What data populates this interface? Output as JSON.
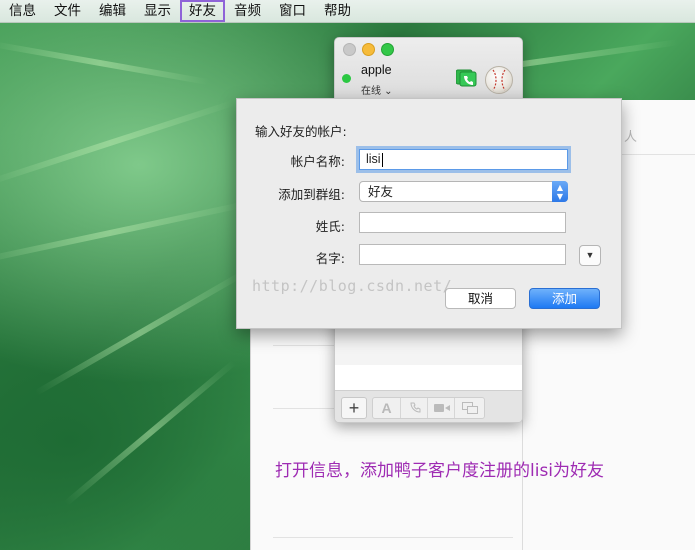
{
  "menubar": {
    "items": [
      "信息",
      "文件",
      "编辑",
      "显示",
      "好友",
      "音频",
      "窗口",
      "帮助"
    ],
    "active_index": 4
  },
  "messages_window": {
    "account_name": "apple",
    "account_status": "在线 ⌄",
    "status_color": "#2bc842"
  },
  "dialog": {
    "title": "输入好友的帐户:",
    "fields": {
      "account_label": "帐户名称:",
      "account_value": "lisi",
      "group_label": "添加到群组:",
      "group_value": "好友",
      "last_name_label": "姓氏:",
      "last_name_value": "",
      "first_name_label": "名字:",
      "first_name_value": ""
    },
    "cancel_label": "取消",
    "add_label": "添加",
    "accent_color": "#1e79f3"
  },
  "background_doc": {
    "ghost_text": "人"
  },
  "watermark": "http://blog.csdn.net/",
  "caption": "打开信息，添加鸭子客户度注册的lisi为好友"
}
